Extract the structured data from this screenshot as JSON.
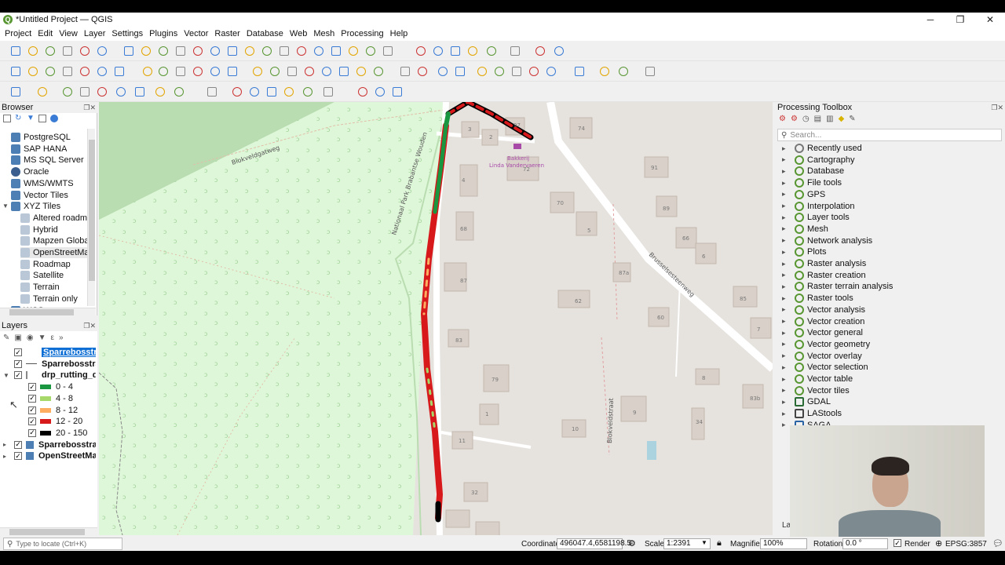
{
  "window": {
    "title": "*Untitled Project — QGIS",
    "logo": "Q",
    "min": "─",
    "max": "❐",
    "close": "✕"
  },
  "menu": [
    "Project",
    "Edit",
    "View",
    "Layer",
    "Settings",
    "Plugins",
    "Vector",
    "Raster",
    "Database",
    "Web",
    "Mesh",
    "Processing",
    "Help"
  ],
  "browser": {
    "title": "Browser",
    "items": [
      {
        "label": "PostgreSQL",
        "icon": "postgres-icon",
        "indent": 0
      },
      {
        "label": "SAP HANA",
        "icon": "saphana-icon",
        "indent": 0
      },
      {
        "label": "MS SQL Server",
        "icon": "mssql-icon",
        "indent": 0
      },
      {
        "label": "Oracle",
        "icon": "oracle-icon",
        "indent": 0
      },
      {
        "label": "WMS/WMTS",
        "icon": "wms-icon",
        "indent": 0
      },
      {
        "label": "Vector Tiles",
        "icon": "grid-icon",
        "indent": 0
      },
      {
        "label": "XYZ Tiles",
        "icon": "grid-icon",
        "indent": 0
      },
      {
        "label": "Altered roadma",
        "icon": "tile-icon",
        "indent": 1
      },
      {
        "label": "Hybrid",
        "icon": "tile-icon",
        "indent": 1
      },
      {
        "label": "Mapzen Global",
        "icon": "tile-icon",
        "indent": 1
      },
      {
        "label": "OpenStreetMap",
        "icon": "tile-icon",
        "indent": 1
      },
      {
        "label": "Roadmap",
        "icon": "tile-icon",
        "indent": 1
      },
      {
        "label": "Satellite",
        "icon": "tile-icon",
        "indent": 1
      },
      {
        "label": "Terrain",
        "icon": "tile-icon",
        "indent": 1
      },
      {
        "label": "Terrain only",
        "icon": "tile-icon",
        "indent": 1
      },
      {
        "label": "WCS",
        "icon": "wcs-icon",
        "indent": 0
      }
    ]
  },
  "layers": {
    "title": "Layers",
    "items": [
      {
        "label": "Sparrebosstraa",
        "bold": true,
        "selected": true,
        "indent": 0
      },
      {
        "label": "Sparrebosstraa",
        "bold": true,
        "selected": false,
        "indent": 0
      },
      {
        "label": "drp_rutting_qgi",
        "bold": true,
        "selected": false,
        "indent": 0
      },
      {
        "label": "0 - 4",
        "bold": false,
        "color": "#1a9641",
        "indent": 1
      },
      {
        "label": "4 - 8",
        "bold": false,
        "color": "#a6d96a",
        "indent": 1
      },
      {
        "label": "8 - 12",
        "bold": false,
        "color": "#fdae61",
        "indent": 1
      },
      {
        "label": "12 - 20",
        "bold": false,
        "color": "#d7191c",
        "indent": 1
      },
      {
        "label": "20 - 150",
        "bold": false,
        "color": "#000000",
        "indent": 1
      },
      {
        "label": "Sparrebosstraa",
        "bold": true,
        "selected": false,
        "indent": 0
      },
      {
        "label": "OpenStreetMap",
        "bold": true,
        "selected": false,
        "indent": 0
      }
    ]
  },
  "map": {
    "streets": [
      "Blokveldgatweg",
      "Nationaal Park Brabantse Wouden",
      "Brusselsesteenweg",
      "Blokveldstraat"
    ],
    "poi": "Bakkerij\nLinda Vandervaeren",
    "poi_line1": "Bakkerij",
    "poi_line2": "Linda Vandervaeren",
    "house_numbers": [
      "3",
      "2",
      "97",
      "74",
      "4",
      "72",
      "91",
      "70",
      "89",
      "5",
      "68",
      "66",
      "6",
      "87",
      "87a",
      "62",
      "85",
      "60",
      "7",
      "83",
      "8",
      "79",
      "83b",
      "9",
      "1",
      "10",
      "11",
      "34",
      "32"
    ]
  },
  "toolbox": {
    "title": "Processing Toolbox",
    "search_placeholder": "Search...",
    "items": [
      "Recently used",
      "Cartography",
      "Database",
      "File tools",
      "GPS",
      "Interpolation",
      "Layer tools",
      "Mesh",
      "Network analysis",
      "Plots",
      "Raster analysis",
      "Raster creation",
      "Raster terrain analysis",
      "Raster tools",
      "Vector analysis",
      "Vector creation",
      "Vector general",
      "Vector geometry",
      "Vector overlay",
      "Vector selection",
      "Vector table",
      "Vector tiles",
      "GDAL",
      "LAStools",
      "SAGA"
    ]
  },
  "status": {
    "locate_placeholder": "Type to locate (Ctrl+K)",
    "coordinate_label": "Coordinate",
    "coordinate": "496047.4,6581198.5",
    "scale_label": "Scale",
    "scale": "1:2391",
    "magnifier_label": "Magnifier",
    "magnifier": "100%",
    "rotation_label": "Rotation",
    "rotation": "0.0 °",
    "render_label": "Render",
    "crs": "EPSG:3857"
  },
  "colors": {
    "accent": "#0f6fd5",
    "qgis_green": "#589632",
    "forest": "#dff7d9",
    "dark_forest": "#b9ddb1"
  }
}
